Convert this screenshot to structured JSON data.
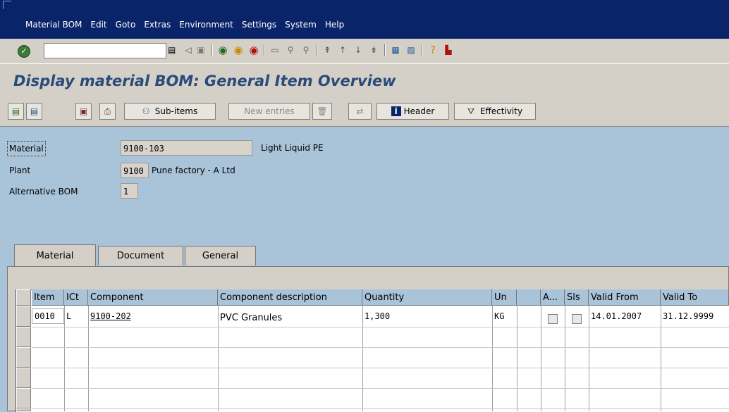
{
  "menu": [
    "Material BOM",
    "Edit",
    "Goto",
    "Extras",
    "Environment",
    "Settings",
    "System",
    "Help"
  ],
  "title": "Display material BOM: General Item Overview",
  "app_toolbar": {
    "subitems_label": "Sub-items",
    "new_entries_label": "New entries",
    "header_label": "Header",
    "effectivity_label": "Effectivity"
  },
  "header_fields": {
    "material_label": "Material",
    "material_value": "9100-103",
    "material_desc": "Light Liquid PE",
    "plant_label": "Plant",
    "plant_value": "9100",
    "plant_desc": "Pune factory - A Ltd",
    "altbom_label": "Alternative BOM",
    "altbom_value": "1"
  },
  "tabs": [
    "Material",
    "Document",
    "General"
  ],
  "table": {
    "columns": [
      "Item",
      "ICt",
      "Component",
      "Component description",
      "Quantity",
      "Un",
      "",
      "A...",
      "Sls",
      "Valid From",
      "Valid To"
    ],
    "rows": [
      {
        "item": "0010",
        "ict": "L",
        "component": "9100-202",
        "description": "PVC Granules",
        "quantity": "1,300",
        "unit": "KG",
        "valid_from": "14.01.2007",
        "valid_to": "31.12.9999"
      }
    ]
  },
  "colors": {
    "menubar": "#0a246a",
    "title": "#2a4a7a",
    "background": "#a9c3d8"
  }
}
